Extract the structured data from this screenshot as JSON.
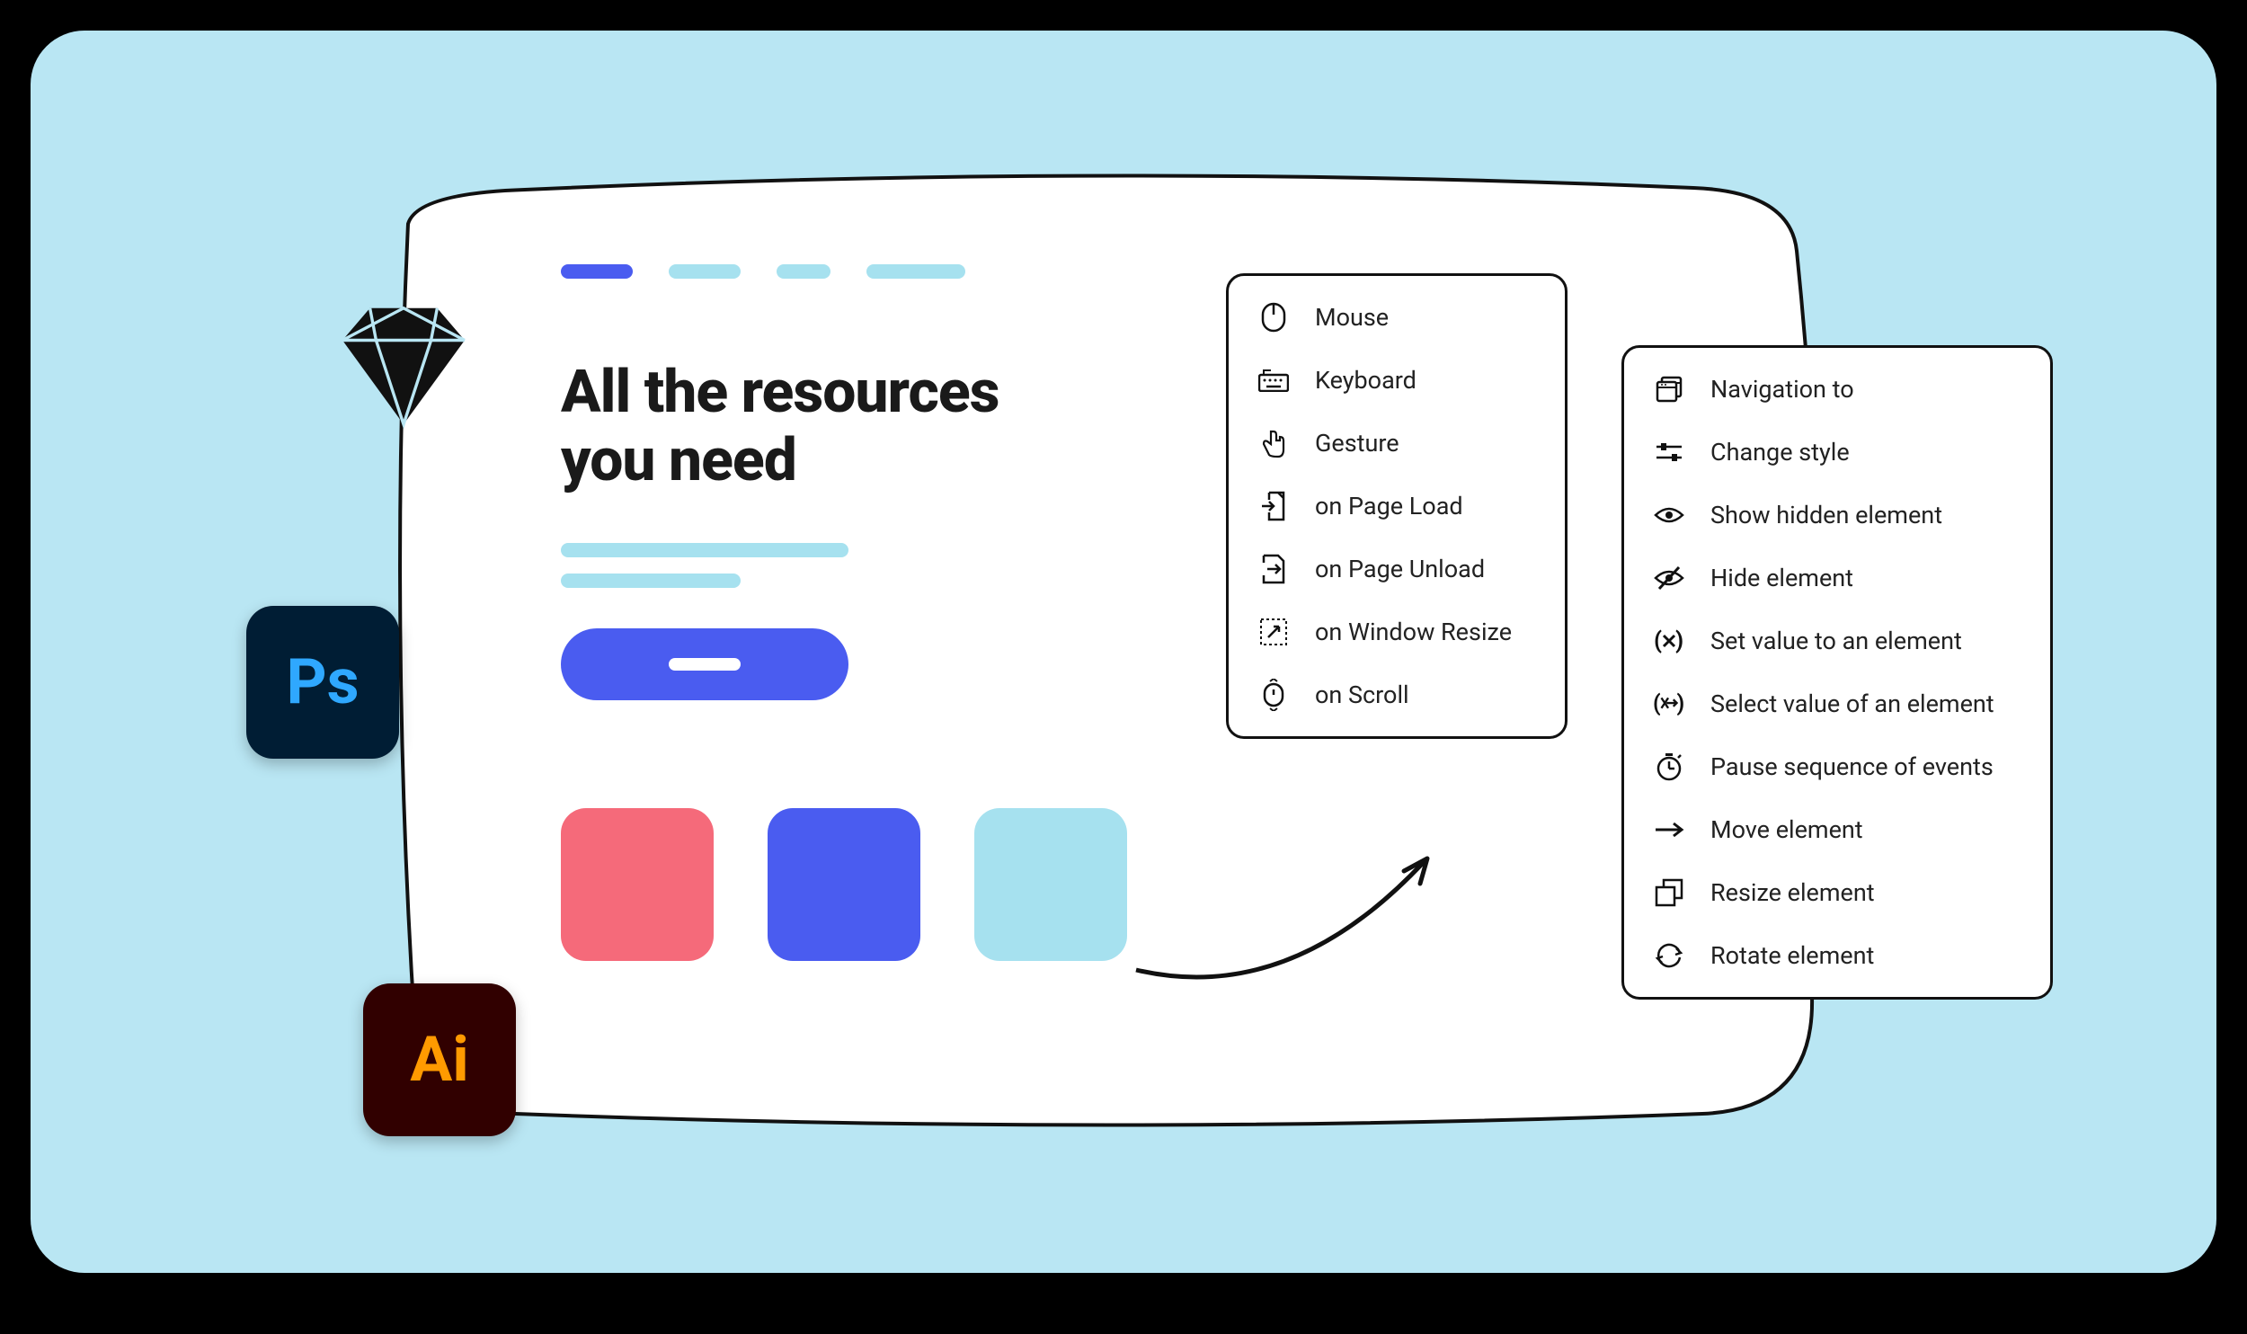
{
  "hero": {
    "headline": "All the resources you need"
  },
  "app_badges": {
    "sketch": "Sketch",
    "photoshop": "Ps",
    "illustrator": "Ai"
  },
  "swatch_colors": {
    "red": "#f56a7a",
    "blue": "#4a5cf0",
    "cyan": "#a6e1ef"
  },
  "triggers": [
    {
      "icon": "mouse-icon",
      "label": "Mouse"
    },
    {
      "icon": "keyboard-icon",
      "label": "Keyboard"
    },
    {
      "icon": "gesture-icon",
      "label": "Gesture"
    },
    {
      "icon": "page-load-icon",
      "label": "on Page Load"
    },
    {
      "icon": "page-unload-icon",
      "label": "on Page Unload"
    },
    {
      "icon": "window-resize-icon",
      "label": "on Window Resize"
    },
    {
      "icon": "scroll-icon",
      "label": "on Scroll"
    }
  ],
  "actions": [
    {
      "icon": "navigation-icon",
      "label": "Navigation to"
    },
    {
      "icon": "change-style-icon",
      "label": "Change style"
    },
    {
      "icon": "show-hidden-icon",
      "label": "Show hidden element"
    },
    {
      "icon": "hide-element-icon",
      "label": "Hide element"
    },
    {
      "icon": "set-value-icon",
      "label": "Set value to an element"
    },
    {
      "icon": "select-value-icon",
      "label": "Select value of an element"
    },
    {
      "icon": "pause-icon",
      "label": "Pause sequence of events"
    },
    {
      "icon": "move-icon",
      "label": "Move element"
    },
    {
      "icon": "resize-icon",
      "label": "Resize element"
    },
    {
      "icon": "rotate-icon",
      "label": "Rotate element"
    }
  ]
}
